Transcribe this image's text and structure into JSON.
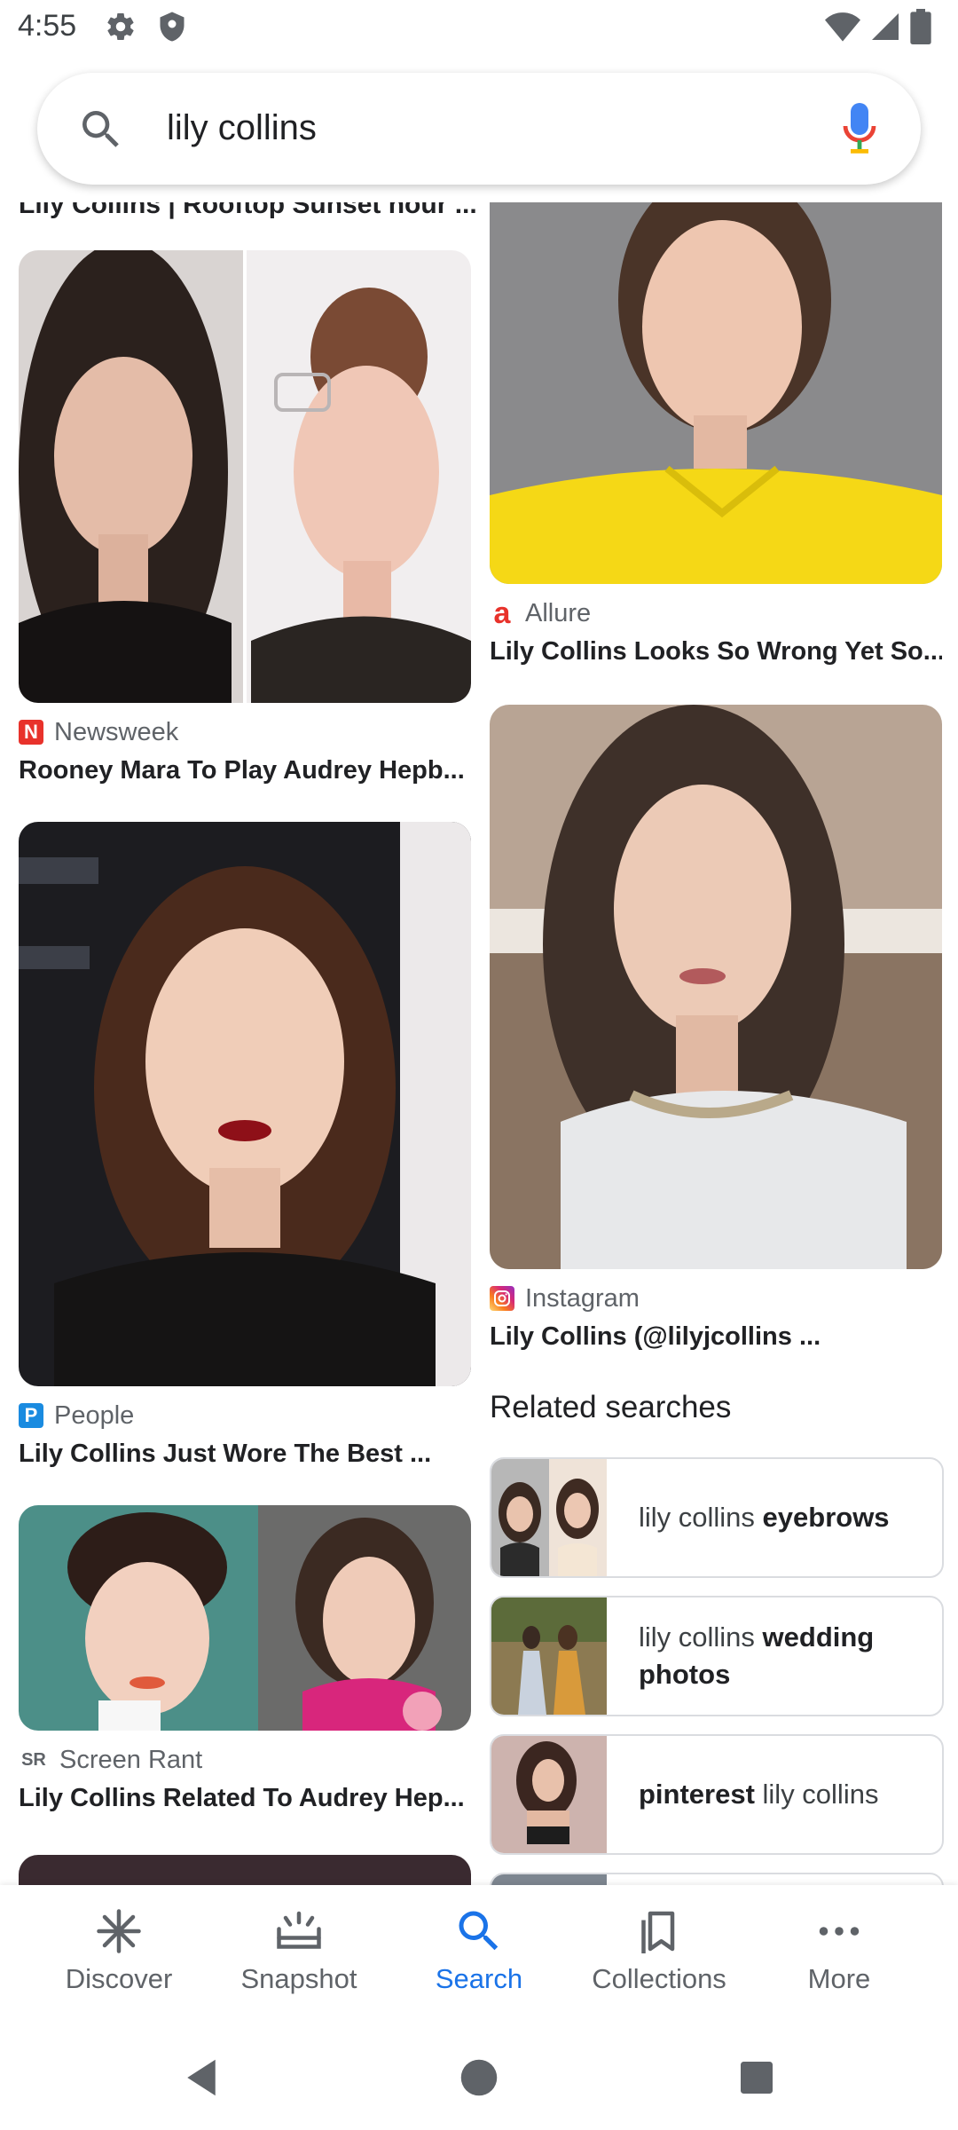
{
  "status_bar": {
    "time": "4:55",
    "left_icons": [
      "gear-icon",
      "shield-icon"
    ],
    "right_icons": [
      "wifi-icon",
      "signal-icon",
      "battery-icon"
    ]
  },
  "search": {
    "query": "lily collins",
    "icons": [
      "search-icon",
      "mic-icon"
    ]
  },
  "results": {
    "cut_off_title": "Lily Collins | Rooftop Sunset hour ...",
    "left_column": [
      {
        "source": "Newsweek",
        "title": "Rooney Mara To Play Audrey Hepb...",
        "icon_letter": "N",
        "icon_color": "#e8322b"
      },
      {
        "source": "People",
        "title": "Lily Collins Just Wore The Best ...",
        "icon_letter": "P",
        "icon_color": "#1a8be0"
      },
      {
        "source": "Screen Rant",
        "title": "Lily Collins Related To Audrey Hep...",
        "icon_letter": "SR",
        "icon_color": "#5f6368"
      }
    ],
    "right_column": [
      {
        "source": "Allure",
        "title": "Lily Collins Looks So Wrong Yet So...",
        "icon_letter": "a",
        "icon_color": "#e8322b"
      },
      {
        "source": "Instagram",
        "title": "Lily Collins (@lilyjcollins ...",
        "icon_letter": "",
        "icon_color": "#d62976"
      }
    ]
  },
  "related_searches": {
    "heading": "Related searches",
    "items": [
      {
        "plain_before": "lily collins ",
        "bold": "eyebrows",
        "plain_after": ""
      },
      {
        "plain_before": "lily collins ",
        "bold": "wedding photos",
        "plain_after": ""
      },
      {
        "plain_before": "",
        "bold": "pinterest",
        "plain_after": " lily collins"
      }
    ]
  },
  "bottom_nav": {
    "items": [
      {
        "label": "Discover",
        "icon": "asterisk-icon",
        "active": false
      },
      {
        "label": "Snapshot",
        "icon": "snapshot-icon",
        "active": false
      },
      {
        "label": "Search",
        "icon": "search-icon",
        "active": true
      },
      {
        "label": "Collections",
        "icon": "bookmarks-icon",
        "active": false
      },
      {
        "label": "More",
        "icon": "more-dots-icon",
        "active": false
      }
    ],
    "active_color": "#1a73e8"
  },
  "system_nav": {
    "buttons": [
      "back-icon",
      "home-icon",
      "recents-icon"
    ]
  }
}
